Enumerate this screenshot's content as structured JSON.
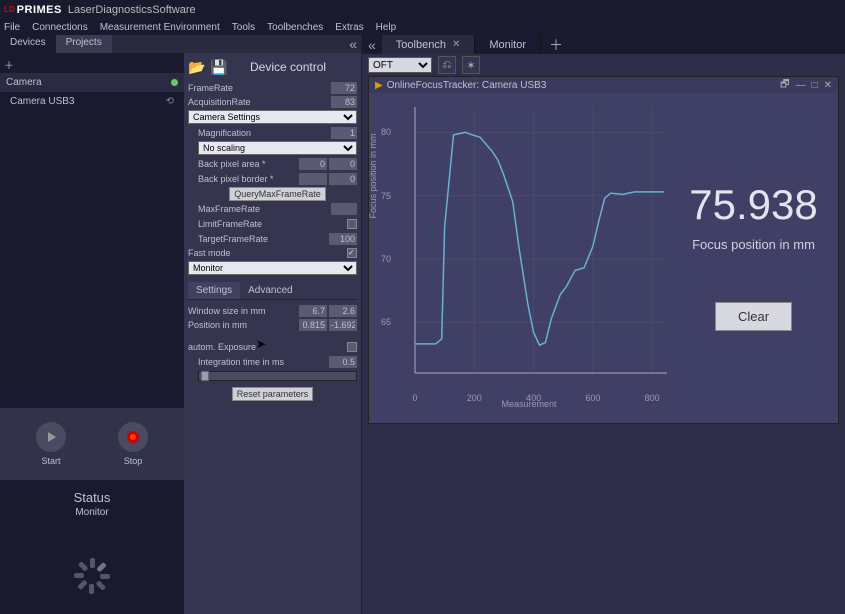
{
  "title": {
    "logo": "LD",
    "brand": "PRIMES",
    "subtitle": "LaserDiagnosticsSoftware"
  },
  "menu": [
    "File",
    "Connections",
    "Measurement Environment",
    "Tools",
    "Toolbenches",
    "Extras",
    "Help"
  ],
  "left": {
    "tabs": {
      "devices": "Devices",
      "projects": "Projects"
    },
    "device_group": "Camera",
    "device_item": "Camera USB3",
    "start": "Start",
    "stop": "Stop",
    "status_title": "Status",
    "status_sub": "Monitor"
  },
  "middle": {
    "title": "Device control",
    "framerate": "FrameRate",
    "framerate_val": "72",
    "acqrate": "AcquisitionRate",
    "acqrate_val": "83",
    "camera_settings": "Camera Settings",
    "magnification": "Magnification",
    "magnification_val": "1",
    "no_scaling": "No scaling",
    "back_pixel_area": "Back pixel area *",
    "bpa_a": "0",
    "bpa_b": "0",
    "back_pixel_border": "Back pixel border *",
    "bpb_a": "",
    "bpb_b": "0",
    "querymax": "QueryMaxFrameRate",
    "maxframerate": "MaxFrameRate",
    "maxframerate_val": "",
    "limitframerate": "LimitFrameRate",
    "targetframerate": "TargetFrameRate",
    "targetframerate_val": "100",
    "fast_mode": "Fast mode",
    "monitor": "Monitor",
    "subtab_settings": "Settings",
    "subtab_advanced": "Advanced",
    "window_size": "Window size in mm",
    "ws_a": "6.7",
    "ws_b": "2.6",
    "position_mm": "Position in mm",
    "pos_a": "0.815",
    "pos_b": "-1.692",
    "autoexp": "autom. Exposure",
    "inttime": "Integration time in ms",
    "inttime_val": "0.5",
    "reset": "Reset parameters"
  },
  "right": {
    "toolbench": "Toolbench",
    "monitor": "Monitor",
    "oft": "OFT",
    "chart_title": "OnlineFocusTracker: Camera USB3",
    "ylab": "Focus position in mm",
    "xlab": "Measurement",
    "readout_val": "75.938",
    "readout_lbl": "Focus position in mm",
    "clear": "Clear"
  },
  "chart_data": {
    "type": "line",
    "title": "OnlineFocusTracker: Camera USB3",
    "ylabel": "Focus position in mm",
    "xlabel": "Measurement",
    "xlim": [
      0,
      850
    ],
    "ylim": [
      61,
      82
    ],
    "xticks": [
      0,
      200,
      400,
      600,
      800
    ],
    "yticks": [
      65,
      70,
      75,
      80
    ],
    "x": [
      0,
      70,
      90,
      100,
      130,
      170,
      180,
      220,
      260,
      280,
      300,
      330,
      350,
      380,
      400,
      420,
      440,
      460,
      490,
      510,
      540,
      570,
      600,
      620,
      640,
      660,
      700,
      740,
      800,
      840
    ],
    "y": [
      63.3,
      63.3,
      63.7,
      72.5,
      79.8,
      80.0,
      79.9,
      79.6,
      78.5,
      77.8,
      76.6,
      74.5,
      71.0,
      66.5,
      64.2,
      63.2,
      63.4,
      65.3,
      67.2,
      67.8,
      69.1,
      69.3,
      71.0,
      73.0,
      74.8,
      75.2,
      75.1,
      75.3,
      75.3,
      75.3
    ]
  }
}
